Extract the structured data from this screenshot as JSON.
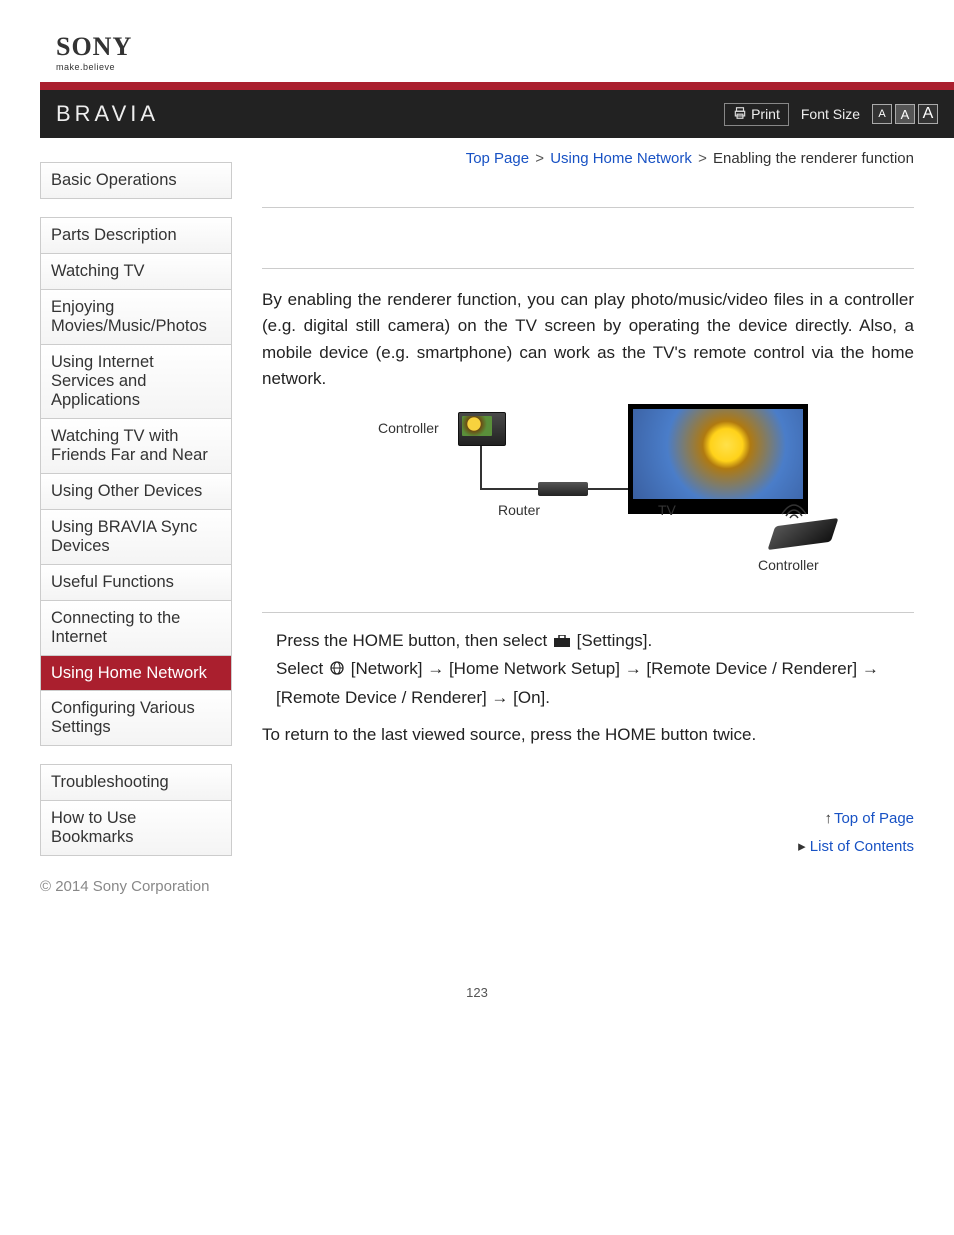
{
  "brand": {
    "logo": "SONY",
    "tagline": "make.believe",
    "product": "BRAVIA"
  },
  "toolbar": {
    "print": "Print",
    "font_size_label": "Font Size"
  },
  "breadcrumb": {
    "items": [
      "Top Page",
      "Using Home Network"
    ],
    "current": "Enabling the renderer function",
    "sep": ">"
  },
  "sidebar": {
    "group1": [
      "Basic Operations"
    ],
    "group2": [
      "Parts Description",
      "Watching TV",
      "Enjoying Movies/Music/Photos",
      "Using Internet Services and Applications",
      "Watching TV with Friends Far and Near",
      "Using Other Devices",
      "Using BRAVIA Sync Devices",
      "Useful Functions",
      "Connecting to the Internet",
      "Using Home Network",
      "Configuring Various Settings"
    ],
    "group3": [
      "Troubleshooting",
      "How to Use Bookmarks"
    ],
    "active": "Using Home Network"
  },
  "content": {
    "intro": "By enabling the renderer function, you can play photo/music/video files in a controller (e.g. digital still camera) on the TV screen by operating the device directly. Also, a mobile device (e.g. smartphone) can work as the TV's remote control via the home network.",
    "diagram": {
      "controller": "Controller",
      "router": "Router",
      "tv": "TV",
      "controller2": "Controller"
    },
    "step1": "Press the HOME button, then select ",
    "step1b": " [Settings].",
    "step2": "Select ",
    "step2b": " [Network] → [Home Network Setup] → [Remote Device / Renderer] → [Remote Device / Renderer] → [On].",
    "note": "To return to the last viewed source, press the HOME button twice."
  },
  "links": {
    "top_of_page": "Top of Page",
    "list_of_contents": "List of Contents"
  },
  "footer": {
    "copyright": "© 2014 Sony Corporation"
  },
  "page_number": "123"
}
